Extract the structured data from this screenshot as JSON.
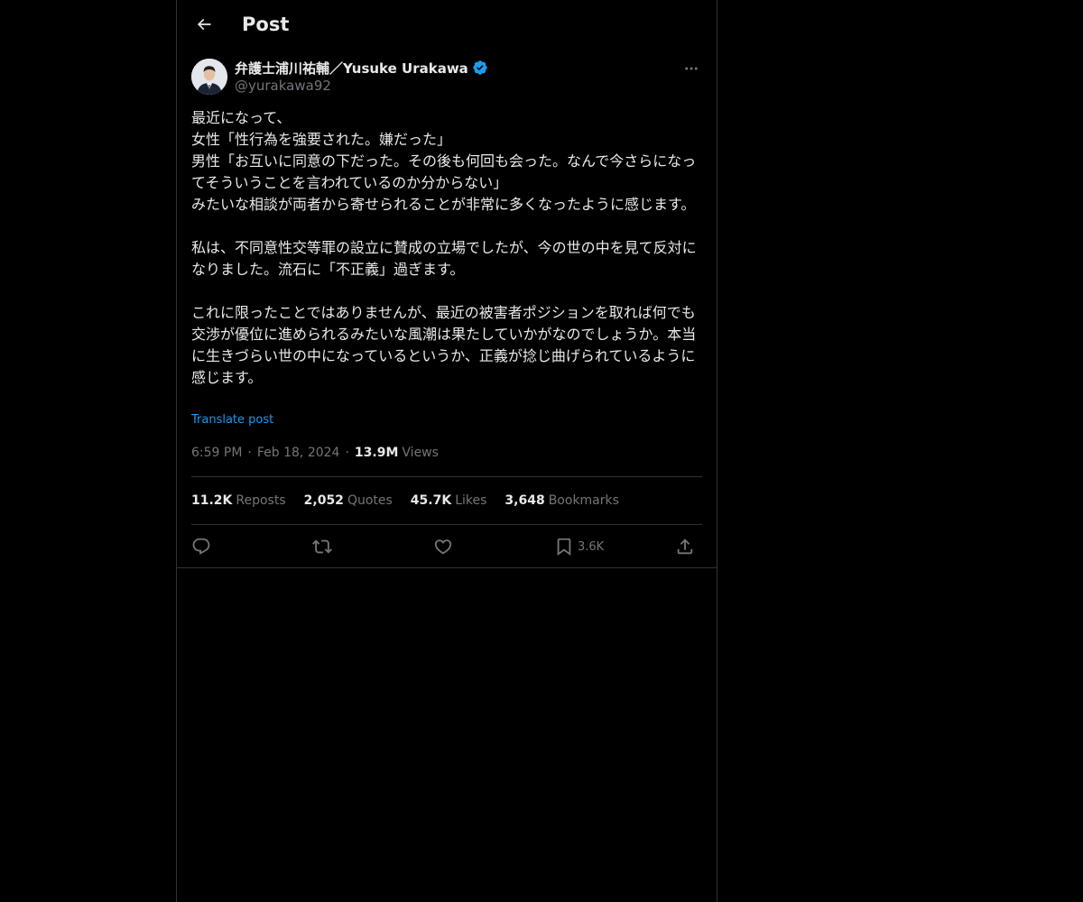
{
  "header": {
    "title": "Post"
  },
  "author": {
    "name": "弁護士浦川祐輔／Yusuke Urakawa",
    "handle": "@yurakawa92",
    "verified": true
  },
  "post": {
    "paragraphs": [
      "最近になって、\n女性「性行為を強要された。嫌だった」\n男性「お互いに同意の下だった。その後も何回も会った。なんで今さらになってそういうことを言われているのか分からない」\nみたいな相談が両者から寄せられることが非常に多くなったように感じます。",
      "私は、不同意性交等罪の設立に賛成の立場でしたが、今の世の中を見て反対になりました。流石に「不正義」過ぎます。",
      "これに限ったことではありませんが、最近の被害者ポジションを取れば何でも交渉が優位に進められるみたいな風潮は果たしていかがなのでしょうか。本当に生きづらい世の中になっているというか、正義が捻じ曲げられているように感じます。"
    ],
    "translate_label": "Translate post",
    "time": "6:59 PM",
    "date": "Feb 18, 2024",
    "views_count": "13.9M",
    "views_label": "Views"
  },
  "stats": {
    "reposts_count": "11.2K",
    "reposts_label": "Reposts",
    "quotes_count": "2,052",
    "quotes_label": "Quotes",
    "likes_count": "45.7K",
    "likes_label": "Likes",
    "bookmarks_count": "3,648",
    "bookmarks_label": "Bookmarks"
  },
  "actions": {
    "reply_icon": "reply-icon",
    "repost_icon": "repost-icon",
    "like_icon": "heart-icon",
    "bookmark_icon": "bookmark-icon",
    "bookmark_count": "3.6K",
    "share_icon": "share-icon"
  },
  "colors": {
    "background": "#000000",
    "text": "#e7e9ea",
    "secondary": "#71767b",
    "accent": "#1d9bf0",
    "border": "#2f3336"
  }
}
